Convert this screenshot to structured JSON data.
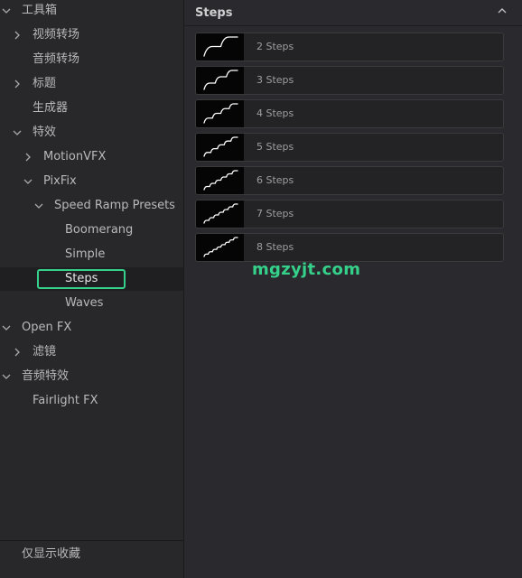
{
  "tree": {
    "items": [
      {
        "label": "工具箱",
        "chevron": "down"
      },
      {
        "label": "视频转场",
        "chevron": "right"
      },
      {
        "label": "音频转场",
        "chevron": ""
      },
      {
        "label": "标题",
        "chevron": "right"
      },
      {
        "label": "生成器",
        "chevron": ""
      },
      {
        "label": "特效",
        "chevron": "down"
      },
      {
        "label": "MotionVFX",
        "chevron": "right"
      },
      {
        "label": "PixFix",
        "chevron": "down"
      },
      {
        "label": "Speed Ramp Presets",
        "chevron": "down"
      },
      {
        "label": "Boomerang",
        "chevron": ""
      },
      {
        "label": "Simple",
        "chevron": ""
      },
      {
        "label": "Steps",
        "chevron": "",
        "selected": true
      },
      {
        "label": "Waves",
        "chevron": ""
      },
      {
        "label": "Open FX",
        "chevron": "down"
      },
      {
        "label": "滤镜",
        "chevron": "right"
      },
      {
        "label": "音频特效",
        "chevron": "down"
      },
      {
        "label": "Fairlight FX",
        "chevron": ""
      }
    ],
    "favorites_only": "仅显示收藏"
  },
  "content": {
    "title": "Steps",
    "collapse_icon": "chevron-up-icon",
    "items": [
      {
        "label": "2 Steps",
        "steps": 2
      },
      {
        "label": "3 Steps",
        "steps": 3
      },
      {
        "label": "4 Steps",
        "steps": 4
      },
      {
        "label": "5 Steps",
        "steps": 5
      },
      {
        "label": "6 Steps",
        "steps": 6
      },
      {
        "label": "7 Steps",
        "steps": 7
      },
      {
        "label": "8 Steps",
        "steps": 8
      }
    ]
  },
  "watermark": "mgzyjt.com",
  "colors": {
    "accent": "#35d18a",
    "panel": "#28282b",
    "content": "#2a2a2e"
  }
}
